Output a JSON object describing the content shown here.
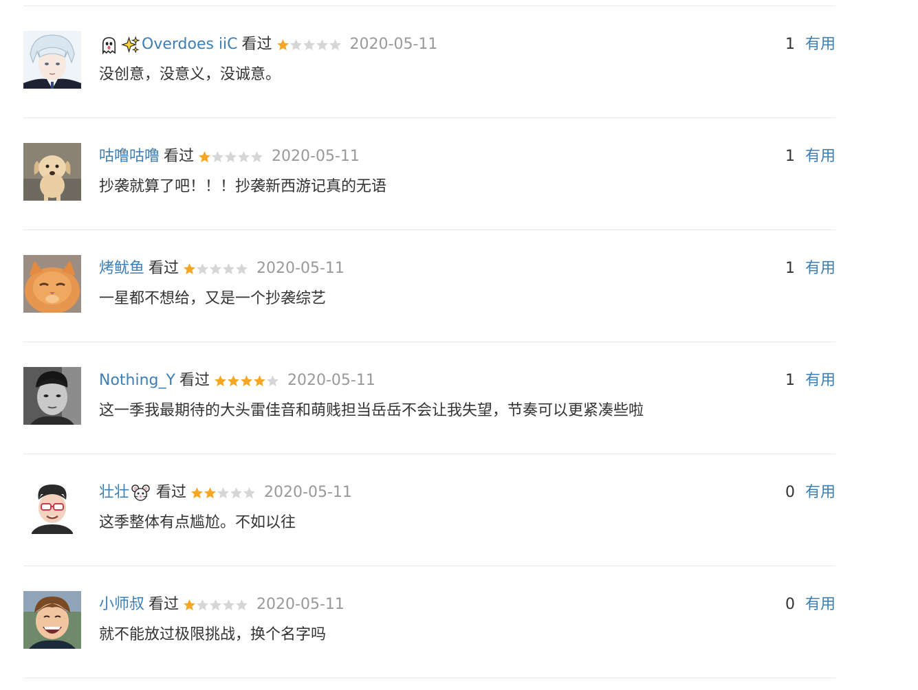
{
  "colors": {
    "link": "#3d7eb3",
    "text": "#333333",
    "date": "#999999",
    "divider": "#e8e8e8",
    "star_on": "#f5a623",
    "star_off": "#d6d6d6"
  },
  "comments": [
    {
      "avatar_icon": "avatar-anime-silver-hair",
      "name_emojis": [
        "ghost-emoji",
        "sparkles-emoji"
      ],
      "user": "Overdoes iiC",
      "status": "看过",
      "rating": 1,
      "rating_max": 5,
      "date": "2020-05-11",
      "votes": "1",
      "useful_label": "有用",
      "text": "没创意，没意义，没诚意。"
    },
    {
      "avatar_icon": "avatar-puppy",
      "name_emojis": [],
      "user": "咕噜咕噜",
      "status": "看过",
      "rating": 1,
      "rating_max": 5,
      "date": "2020-05-11",
      "votes": "1",
      "useful_label": "有用",
      "text": "抄袭就算了吧！！！抄袭新西游记真的无语"
    },
    {
      "avatar_icon": "avatar-orange-cat",
      "name_emojis": [],
      "user": "烤鱿鱼",
      "status": "看过",
      "rating": 1,
      "rating_max": 5,
      "date": "2020-05-11",
      "votes": "1",
      "useful_label": "有用",
      "text": "一星都不想给，又是一个抄袭综艺"
    },
    {
      "avatar_icon": "avatar-man-portrait",
      "name_emojis": [],
      "user": "Nothing_Y",
      "status": "看过",
      "rating": 4,
      "rating_max": 5,
      "date": "2020-05-11",
      "votes": "1",
      "useful_label": "有用",
      "text": "这一季我最期待的大头雷佳音和萌贱担当岳岳不会让我失望，节奏可以更紧凑些啦"
    },
    {
      "avatar_icon": "avatar-cartoon-man",
      "name_emojis": [],
      "user": "壮壮",
      "name_suffix_emojis": [
        "mouse-emoji"
      ],
      "status": "看过",
      "rating": 2,
      "rating_max": 5,
      "date": "2020-05-11",
      "votes": "0",
      "useful_label": "有用",
      "text": "这季整体有点尴尬。不如以往"
    },
    {
      "avatar_icon": "avatar-laughing-child",
      "name_emojis": [],
      "user": "小师叔",
      "status": "看过",
      "rating": 1,
      "rating_max": 5,
      "date": "2020-05-11",
      "votes": "0",
      "useful_label": "有用",
      "text": "就不能放过极限挑战，换个名字吗"
    }
  ]
}
